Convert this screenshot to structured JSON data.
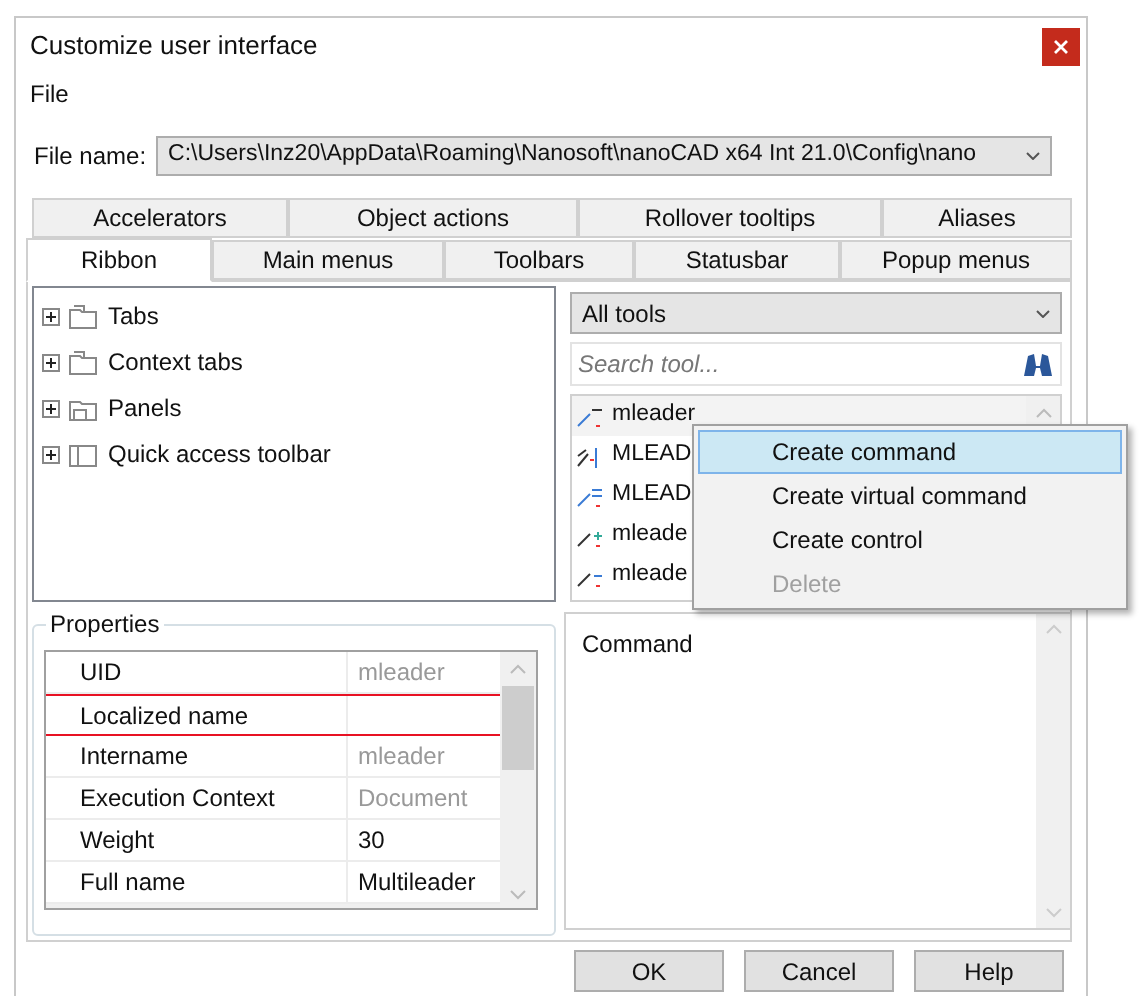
{
  "window": {
    "title": "Customize user interface"
  },
  "menu": [
    "File"
  ],
  "file_name": {
    "label": "File name:",
    "value": "C:\\Users\\Inz20\\AppData\\Roaming\\Nanosoft\\nanoCAD x64 Int 21.0\\Config\\nano"
  },
  "tabs_row_1": [
    {
      "label": "Accelerators",
      "selected": false
    },
    {
      "label": "Object actions",
      "selected": false
    },
    {
      "label": "Rollover tooltips",
      "selected": false
    },
    {
      "label": "Aliases",
      "selected": false
    }
  ],
  "tabs_row_2": [
    {
      "label": "Ribbon",
      "selected": true
    },
    {
      "label": "Main menus",
      "selected": false
    },
    {
      "label": "Toolbars",
      "selected": false
    },
    {
      "label": "Statusbar",
      "selected": false
    },
    {
      "label": "Popup menus",
      "selected": false
    }
  ],
  "tree": [
    {
      "label": "Tabs",
      "expanded": false
    },
    {
      "label": "Context tabs",
      "expanded": false
    },
    {
      "label": "Panels",
      "expanded": false
    },
    {
      "label": "Quick access toolbar",
      "expanded": false
    }
  ],
  "properties": {
    "title": "Properties",
    "rows": [
      {
        "name": "UID",
        "value": "mleader",
        "readonly": true,
        "selected": false
      },
      {
        "name": "Localized name",
        "selected": true
      },
      {
        "name": "Intername",
        "value": "mleader",
        "readonly": true,
        "selected": false
      },
      {
        "name": "Execution Context",
        "value": "Document",
        "readonly": true,
        "selected": false
      },
      {
        "name": "Weight",
        "value": "30",
        "readonly": false,
        "selected": false
      },
      {
        "name": "Full name",
        "value": "Multileader",
        "readonly": false,
        "selected": false
      }
    ]
  },
  "tools": {
    "filter": "All tools",
    "search_placeholder": "Search tool...",
    "items": [
      {
        "label": "mleader"
      },
      {
        "label": "MLEAD"
      },
      {
        "label": "MLEAD"
      },
      {
        "label": "mleade"
      },
      {
        "label": "mleade"
      }
    ]
  },
  "context_menu": [
    {
      "label": "Create command",
      "selected": true,
      "disabled": false
    },
    {
      "label": "Create virtual command",
      "selected": false,
      "disabled": false
    },
    {
      "label": "Create control",
      "selected": false,
      "disabled": false
    },
    {
      "label": "Delete",
      "selected": false,
      "disabled": true
    }
  ],
  "command_panel": {
    "text": "Command"
  },
  "buttons": [
    "OK",
    "Cancel",
    "Help"
  ]
}
